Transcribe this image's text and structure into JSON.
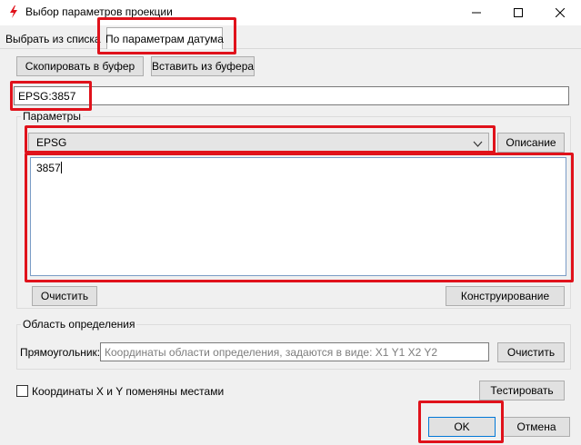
{
  "window": {
    "title": "Выбор параметров проекции",
    "icon": "app-lightning-icon",
    "controls": [
      "minimize-icon",
      "maximize-icon",
      "close-icon"
    ]
  },
  "tabs": [
    {
      "label": "Выбрать из списка",
      "active": false
    },
    {
      "label": "По параметрам датума",
      "active": true
    }
  ],
  "toolbar": {
    "copy_label": "Скопировать в буфер",
    "paste_label": "Вставить из буфера"
  },
  "projection_string": "EPSG:3857",
  "params": {
    "group_label": "Параметры",
    "selected_type": "EPSG",
    "describe_label": "Описание",
    "text_value": "3857",
    "clear_label": "Очистить",
    "construct_label": "Конструирование"
  },
  "extent": {
    "group_label": "Область определения",
    "rect_label": "Прямоугольник:",
    "placeholder": "Координаты области определения, задаются в виде: X1 Y1 X2 Y2",
    "clear_label": "Очистить"
  },
  "swap_xy": {
    "label": "Координаты X и Y поменяны местами",
    "checked": false
  },
  "test_label": "Тестировать",
  "ok_label": "OK",
  "cancel_label": "Отмена",
  "highlight_color": "#e0121b",
  "accent_color": "#7a9cc6"
}
